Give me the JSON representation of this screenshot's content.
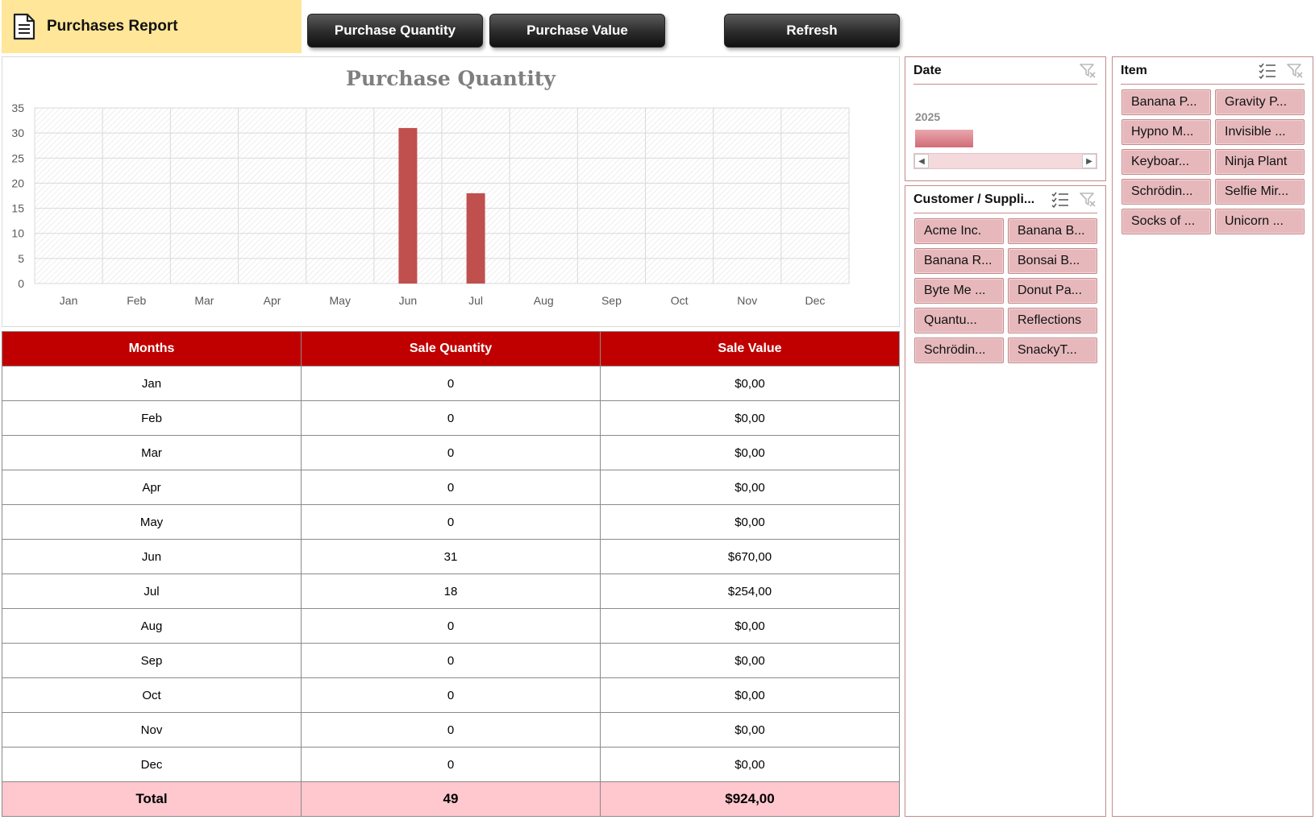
{
  "header": {
    "title": "Purchases Report",
    "icon": "document-icon"
  },
  "toolbar": {
    "purchase_quantity_label": "Purchase Quantity",
    "purchase_value_label": "Purchase Value",
    "refresh_label": "Refresh"
  },
  "chart_data": {
    "type": "bar",
    "title": "Purchase Quantity",
    "categories": [
      "Jan",
      "Feb",
      "Mar",
      "Apr",
      "May",
      "Jun",
      "Jul",
      "Aug",
      "Sep",
      "Oct",
      "Nov",
      "Dec"
    ],
    "values": [
      0,
      0,
      0,
      0,
      0,
      31,
      18,
      0,
      0,
      0,
      0,
      0
    ],
    "yticks": [
      "0",
      "5",
      "10",
      "15",
      "20",
      "25",
      "30",
      "35"
    ],
    "ylim": [
      0,
      35
    ],
    "grid": true,
    "bar_color": "#C0504D"
  },
  "table": {
    "headers": [
      "Months",
      "Sale Quantity",
      "Sale Value"
    ],
    "rows": [
      [
        "Jan",
        "0",
        "$0,00"
      ],
      [
        "Feb",
        "0",
        "$0,00"
      ],
      [
        "Mar",
        "0",
        "$0,00"
      ],
      [
        "Apr",
        "0",
        "$0,00"
      ],
      [
        "May",
        "0",
        "$0,00"
      ],
      [
        "Jun",
        "31",
        "$670,00"
      ],
      [
        "Jul",
        "18",
        "$254,00"
      ],
      [
        "Aug",
        "0",
        "$0,00"
      ],
      [
        "Sep",
        "0",
        "$0,00"
      ],
      [
        "Oct",
        "0",
        "$0,00"
      ],
      [
        "Nov",
        "0",
        "$0,00"
      ],
      [
        "Dec",
        "0",
        "$0,00"
      ]
    ],
    "total": [
      "Total",
      "49",
      "$924,00"
    ]
  },
  "slicers": {
    "date": {
      "title": "Date",
      "year": "2025"
    },
    "customer": {
      "title": "Customer / Suppli...",
      "items": [
        "Acme Inc.",
        "Banana B...",
        "Banana R...",
        "Bonsai B...",
        "Byte Me ...",
        "Donut Pa...",
        "Quantu...",
        "Reflections",
        "Schrödin...",
        "SnackyT..."
      ]
    },
    "item": {
      "title": "Item",
      "items": [
        "Banana P...",
        "Gravity P...",
        "Hypno M...",
        "Invisible ...",
        "Keyboar...",
        "Ninja Plant",
        "Schrödin...",
        "Selfie Mir...",
        "Socks of ...",
        "Unicorn ..."
      ]
    }
  },
  "colors": {
    "title_bg": "#FFE699",
    "table_header": "#C00000",
    "total_row": "#FFC7CE",
    "slicer_chip": "#E6B8BC"
  }
}
